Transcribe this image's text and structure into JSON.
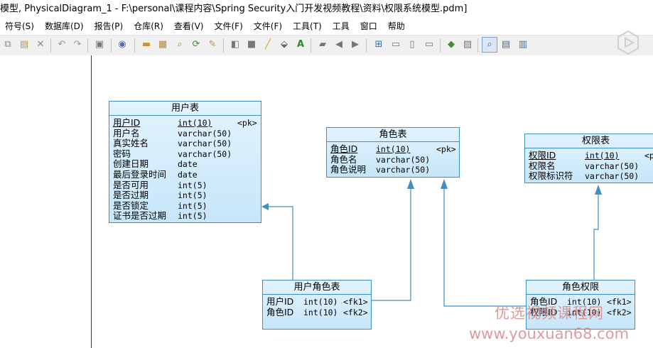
{
  "window": {
    "title": "模型, PhysicalDiagram_1 - F:\\personal\\课程内容\\Spring Security入门开发视频教程\\资料\\权限系统模型.pdm]"
  },
  "menu": [
    "符号(S)",
    "数据库(D)",
    "报告(P)",
    "仓库(R)",
    "查看(V)",
    "文件(F)",
    "文件(F)",
    "工具(T)",
    "工具",
    "窗口",
    "帮助"
  ],
  "tables": {
    "user": {
      "title": "用户表",
      "rows": [
        {
          "name": "用户ID",
          "type": "int(10)",
          "key": "<pk>"
        },
        {
          "name": "用户名",
          "type": "varchar(50)",
          "key": ""
        },
        {
          "name": "真实姓名",
          "type": "varchar(50)",
          "key": ""
        },
        {
          "name": "密码",
          "type": "varchar(50)",
          "key": ""
        },
        {
          "name": "创建日期",
          "type": "date",
          "key": ""
        },
        {
          "name": "最后登录时间",
          "type": "date",
          "key": ""
        },
        {
          "name": "是否可用",
          "type": "int(5)",
          "key": ""
        },
        {
          "name": "是否过期",
          "type": "int(5)",
          "key": ""
        },
        {
          "name": "是否锁定",
          "type": "int(5)",
          "key": ""
        },
        {
          "name": "证书是否过期",
          "type": "int(5)",
          "key": ""
        }
      ]
    },
    "role": {
      "title": "角色表",
      "rows": [
        {
          "name": "角色ID",
          "type": "int(10)",
          "key": "<pk>"
        },
        {
          "name": "角色名",
          "type": "varchar(50)",
          "key": ""
        },
        {
          "name": "角色说明",
          "type": "varchar(50)",
          "key": ""
        }
      ]
    },
    "permission": {
      "title": "权限表",
      "rows": [
        {
          "name": "权限ID",
          "type": "int(10)",
          "key": "<p"
        },
        {
          "name": "权限名",
          "type": "varchar(50)",
          "key": ""
        },
        {
          "name": "权限标识符",
          "type": "varchar(50)",
          "key": ""
        }
      ]
    },
    "user_role": {
      "title": "用户角色表",
      "rows": [
        {
          "name": "用户ID",
          "type": "int(10)",
          "key": "<fk1>"
        },
        {
          "name": "角色ID",
          "type": "int(10)",
          "key": "<fk2>"
        }
      ]
    },
    "role_permission": {
      "title": "角色权限",
      "rows": [
        {
          "name": "角色ID",
          "type": "int(10)",
          "key": "<fk1>"
        },
        {
          "name": "权限ID",
          "type": "int(10)",
          "key": "<fk2>"
        }
      ]
    }
  },
  "watermark": {
    "line1": "优选视频课程网",
    "line2": "www.youxuan68.com"
  },
  "colors": {
    "table_border": "#3d8ec9",
    "table_fill_top": "#e3f3fd",
    "table_fill_bottom": "#c6e6fa",
    "connector": "#3d8ec9",
    "watermark": "#d98a8a"
  }
}
